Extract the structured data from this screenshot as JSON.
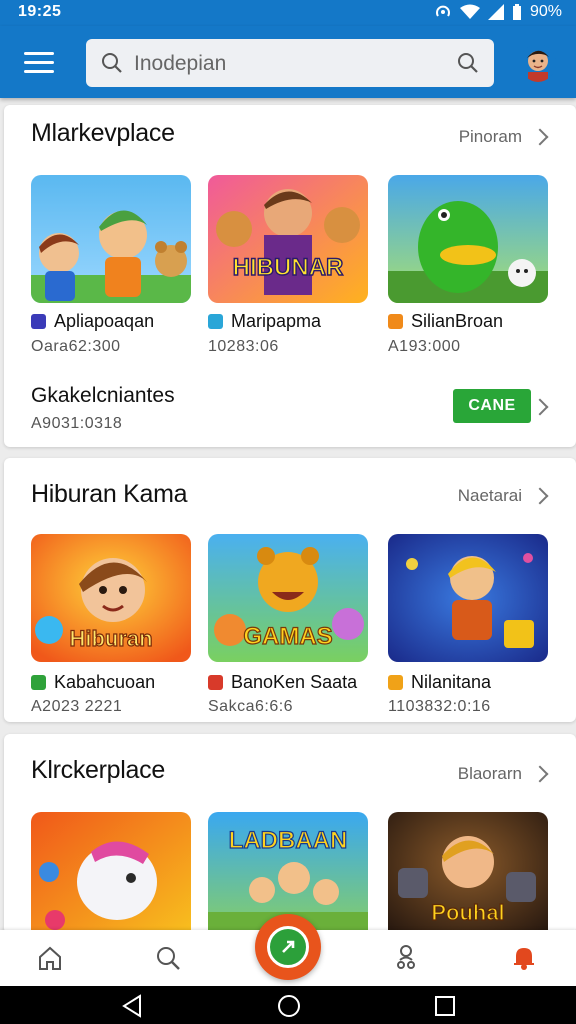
{
  "status_bar": {
    "time": "19:25",
    "battery": "90%"
  },
  "app_bar": {
    "search_text": "Inodepian"
  },
  "sections": [
    {
      "title": "Mlarkevplace",
      "see_all": "Pinoram",
      "items": [
        {
          "name": "Apliapoaqan",
          "sub": "Oara62:300",
          "icon_color": "#3b3bb8",
          "thumb": "Hiburan kids"
        },
        {
          "name": "Maripapma",
          "sub": "10283:06",
          "icon_color": "#2aa6d8",
          "thumb_label": "HIBUNAR"
        },
        {
          "name": "SilianBroan",
          "sub": "A193:000",
          "icon_color": "#f08a1a",
          "thumb": "green dino"
        }
      ],
      "extra_row": {
        "title": "Gkakelcniantes",
        "sub": "A9031:0318",
        "button": "CANE"
      }
    },
    {
      "title": "Hiburan Kama",
      "see_all": "Naetarai",
      "items": [
        {
          "name": "Kabahcuoan",
          "sub": "A2023 2221",
          "icon_color": "#2fa23a",
          "thumb_label": "Hiburan"
        },
        {
          "name": "BanoKen Saata",
          "sub": "Sakca6:6:6",
          "icon_color": "#d83a2a",
          "thumb_label": "GAMAS"
        },
        {
          "name": "Nilanitana",
          "sub": "1103832:0:16",
          "icon_color": "#f0a218",
          "thumb": "adventure hero"
        }
      ]
    },
    {
      "title": "Klrckerplace",
      "see_all": "Blaorarn",
      "items": [
        {
          "thumb": "unicorn"
        },
        {
          "thumb_label": "LADBAAN"
        },
        {
          "thumb_label": "Pouhal"
        }
      ]
    }
  ],
  "colors": {
    "primary": "#1478c8",
    "accent": "#e8541c",
    "button": "#29a638"
  }
}
